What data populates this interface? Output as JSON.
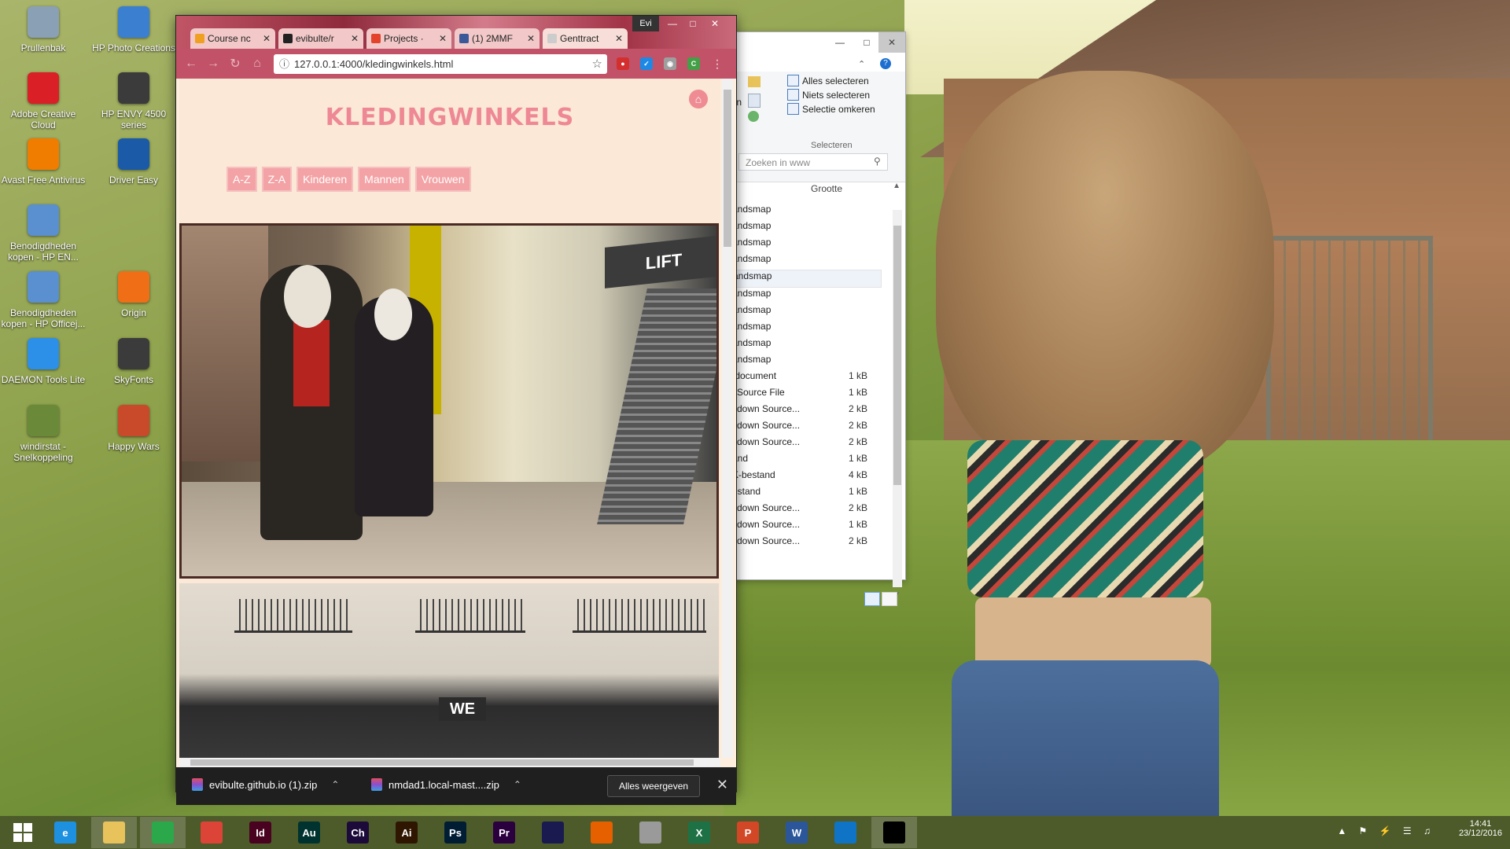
{
  "desktop": {
    "icons": [
      {
        "label": "Prullenbak",
        "icon": "recycle-bin-icon",
        "color": "#8aa0b5"
      },
      {
        "label": "HP Photo Creations",
        "icon": "hp-photo-icon",
        "color": "#3a7fd0"
      },
      {
        "label": "Adobe Creative Cloud",
        "icon": "creative-cloud-icon",
        "color": "#da1f26"
      },
      {
        "label": "HP ENVY 4500 series",
        "icon": "printer-icon",
        "color": "#3b3b3b"
      },
      {
        "label": "Avast Free Antivirus",
        "icon": "avast-icon",
        "color": "#f07c00"
      },
      {
        "label": "Driver Easy",
        "icon": "driver-easy-icon",
        "color": "#1a5aa6"
      },
      {
        "label": "Benodigdheden kopen - HP EN...",
        "icon": "hp-supplies-icon",
        "color": "#5a8fd0"
      },
      {
        "label": "Benodigdheden kopen - HP Officej...",
        "icon": "hp-supplies-icon",
        "color": "#5a8fd0"
      },
      {
        "label": "Origin",
        "icon": "origin-icon",
        "color": "#f06e16"
      },
      {
        "label": "DAEMON Tools Lite",
        "icon": "daemon-tools-icon",
        "color": "#2c8fe8"
      },
      {
        "label": "SkyFonts",
        "icon": "skyfonts-icon",
        "color": "#3b3b3b"
      },
      {
        "label": "windirstat - Snelkoppeling",
        "icon": "windirstat-icon",
        "color": "#6a8a3a"
      },
      {
        "label": "Happy Wars",
        "icon": "happy-wars-icon",
        "color": "#c94a2a"
      }
    ]
  },
  "explorer": {
    "ribbon": {
      "select_all": "Alles selecteren",
      "select_none": "Niets selecteren",
      "invert_selection": "Selectie omkeren",
      "group_label": "Selecteren",
      "open_fragment": "pen",
      "en_fragment": "en"
    },
    "search_placeholder": "Zoeken in www",
    "column_size": "Grootte",
    "files": [
      {
        "type": "andsmap",
        "size": ""
      },
      {
        "type": "andsmap",
        "size": ""
      },
      {
        "type": "andsmap",
        "size": ""
      },
      {
        "type": "andsmap",
        "size": ""
      },
      {
        "type": "andsmap",
        "size": ""
      },
      {
        "type": "andsmap",
        "size": ""
      },
      {
        "type": "andsmap",
        "size": ""
      },
      {
        "type": "andsmap",
        "size": ""
      },
      {
        "type": "andsmap",
        "size": ""
      },
      {
        "type": "andsmap",
        "size": ""
      },
      {
        "type": "tdocument",
        "size": "1 kB"
      },
      {
        "type": "l Source File",
        "size": "1 kB"
      },
      {
        "type": "kdown Source...",
        "size": "2 kB"
      },
      {
        "type": "kdown Source...",
        "size": "2 kB"
      },
      {
        "type": "kdown Source...",
        "size": "2 kB"
      },
      {
        "type": "and",
        "size": "1 kB"
      },
      {
        "type": "K-bestand",
        "size": "4 kB"
      },
      {
        "type": "estand",
        "size": "1 kB"
      },
      {
        "type": "kdown Source...",
        "size": "2 kB"
      },
      {
        "type": "kdown Source...",
        "size": "1 kB"
      },
      {
        "type": "kdown Source...",
        "size": "2 kB"
      }
    ]
  },
  "browser": {
    "profile_name": "Evi",
    "tabs": [
      {
        "title": "Course nc",
        "icon_color": "#f0a020"
      },
      {
        "title": "evibulte/r",
        "icon_color": "#222222"
      },
      {
        "title": "Projects ·",
        "icon_color": "#e2432a"
      },
      {
        "title": "(1) 2MMF",
        "icon_color": "#3b5998"
      },
      {
        "title": "Genttract",
        "icon_color": "#cccccc"
      }
    ],
    "url": "127.0.0.1:4000/kledingwinkels.html",
    "page": {
      "title": "KLEDINGWINKELS",
      "filters": [
        "A-Z",
        "Z-A",
        "Kinderen",
        "Mannen",
        "Vrouwen"
      ],
      "photo1_sign": "LIFT",
      "photo2_logo": "WE"
    },
    "downloads": {
      "items": [
        "evibulte.github.io (1).zip",
        "nmdad1.local-mast....zip"
      ],
      "show_all": "Alles weergeven"
    }
  },
  "taskbar": {
    "apps": [
      {
        "name": "internet-explorer",
        "text": "e",
        "color": "#1e90e0"
      },
      {
        "name": "file-explorer",
        "text": "",
        "color": "#e8c25a"
      },
      {
        "name": "store",
        "text": "",
        "color": "#2aa84a"
      },
      {
        "name": "chrome",
        "text": "",
        "color": "#db4437"
      },
      {
        "name": "indesign",
        "text": "Id",
        "color": "#49021f"
      },
      {
        "name": "audition",
        "text": "Au",
        "color": "#00332f"
      },
      {
        "name": "character-animator",
        "text": "Ch",
        "color": "#1c0b3a"
      },
      {
        "name": "illustrator",
        "text": "Ai",
        "color": "#2e1600"
      },
      {
        "name": "photoshop",
        "text": "Ps",
        "color": "#001d34"
      },
      {
        "name": "premiere",
        "text": "Pr",
        "color": "#2a003f"
      },
      {
        "name": "after-effects",
        "text": "",
        "color": "#1a1a50"
      },
      {
        "name": "firefox",
        "text": "",
        "color": "#e66000"
      },
      {
        "name": "evernote",
        "text": "",
        "color": "#9a9a9a"
      },
      {
        "name": "excel",
        "text": "X",
        "color": "#1e7145"
      },
      {
        "name": "powerpoint",
        "text": "P",
        "color": "#d24726"
      },
      {
        "name": "word",
        "text": "W",
        "color": "#2b579a"
      },
      {
        "name": "visual-studio",
        "text": "",
        "color": "#0f74c5"
      },
      {
        "name": "command-prompt",
        "text": "",
        "color": "#000000"
      }
    ],
    "clock": {
      "time": "14:41",
      "date": "23/12/2016"
    }
  }
}
